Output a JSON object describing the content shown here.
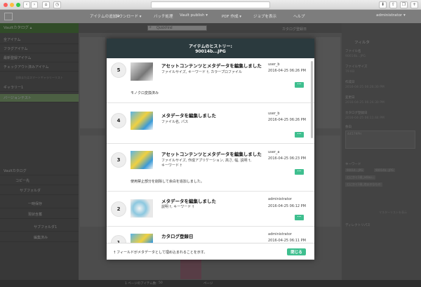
{
  "browser": {
    "url": "",
    "colors": {
      "close": "#fc605c",
      "minimize": "#fdbc40",
      "maximize": "#34c84a"
    }
  },
  "appbar": {
    "menus": [
      "アイテムの追加 ▾",
      "ダウンロード ▾",
      "バッチ処理",
      "Vault publish ▾",
      "PDF 作成 ▾",
      "ジョブを表示",
      "ヘルプ"
    ],
    "user": "administrator ▾"
  },
  "sidebar": {
    "header": "Vaultカタログ ▴",
    "items": [
      "全アイテム",
      "フラグアイテム",
      "最新登録アイテム",
      "チェックアウト済みアイテム",
      "",
      "ギャラリー1",
      "バージョンテスト"
    ],
    "subnote": "全体またはスマートギャラリーリスト",
    "tree_header": "Vaultカタログ",
    "tree_items": [
      "コピー先",
      "サブフォルダ",
      "一時保存",
      "現状含蓄",
      "サブフォルダ1",
      "編集済み"
    ]
  },
  "toolbar": {
    "search_placeholder": "QuickFind",
    "sort_label": "カタログ登録日"
  },
  "rightpanel": {
    "filter_label": "フィルタ",
    "fields": [
      {
        "label": "ファイル名",
        "value": "90014b...JPG"
      },
      {
        "label": "ファイルサイズ",
        "value": "79 KB"
      },
      {
        "label": "作成日",
        "value": "2016-04-25 06:26:30 PM"
      },
      {
        "label": "変更日",
        "value": "2016-04-25 06:26:30 PM"
      },
      {
        "label": "カタログ登録日",
        "value": "2016-04-25 06:11:44 PM"
      },
      {
        "label": "余白",
        "value": "44579PH"
      }
    ],
    "keywords_label": "キーワード",
    "keywords": [
      "90014...JPG",
      "90014b...JPG",
      "とにかく1冊_adiau...",
      "とにかく1冊_地まのなもの"
    ],
    "directory_label": "ディレクトリパス",
    "keyword_list_link": "マスターリストを表示"
  },
  "bottombar": {
    "per_page_label": "1 ページのアイテム数:",
    "per_page_value": "50",
    "page_label": "ページ"
  },
  "modal": {
    "title": "アイテムのヒストリー:",
    "filename": "90014b...JPG",
    "entries": [
      {
        "num": "5",
        "title": "アセットコンテンツとメタデータを編集しました",
        "fields": "ファイルサイズ, キーワード †, カラープロファイル",
        "user": "user_b",
        "date": "2016-04-25 06:26 PM",
        "more": "...",
        "note": "モノクロ変換済み"
      },
      {
        "num": "4",
        "title": "メタデータを編集しました",
        "fields": "ファイル名, パス",
        "user": "user_b",
        "date": "2016-04-25 06:26 PM",
        "more": "...",
        "note": ""
      },
      {
        "num": "3",
        "title": "アセットコンテンツとメタデータを編集しました",
        "fields": "ファイルサイズ, 作成アプリケーション, 高さ, 幅, 説明 †, キーワード †",
        "user": "user_a",
        "date": "2016-04-25 06:23 PM",
        "more": "...",
        "note": "使用禁止部分を削除して余白を追加しました。"
      },
      {
        "num": "2",
        "title": "メタデータを編集しました",
        "fields": "説明 †, キーワード †",
        "user": "administrator",
        "date": "2016-04-25 06:12 PM",
        "more": "...",
        "note": ""
      },
      {
        "num": "1",
        "title": "カタログ登録日",
        "fields": "",
        "user": "administrator",
        "date": "2016-04-25 06:11 PM",
        "more": "",
        "note": ""
      }
    ],
    "footnote": "† フィールドがメタデータとして埋め込まれることを示す。",
    "close_label": "閉じる",
    "accent": "#3fbf8f",
    "header_bg": "#2b3a3e"
  }
}
